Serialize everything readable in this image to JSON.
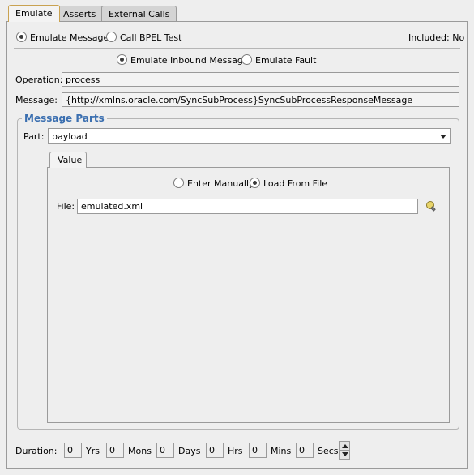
{
  "tabs": [
    {
      "label": "Emulate",
      "active": true
    },
    {
      "label": "Asserts",
      "active": false
    },
    {
      "label": "External Calls",
      "active": false
    }
  ],
  "mode": {
    "emulate_message": "Emulate Message",
    "call_bpel_test": "Call BPEL Test",
    "included": "Included: No",
    "selected": "emulate_message"
  },
  "direction": {
    "emulate_inbound": "Emulate Inbound Message",
    "emulate_fault": "Emulate Fault",
    "selected": "emulate_inbound"
  },
  "operation": {
    "label": "Operation:",
    "value": "process"
  },
  "message": {
    "label": "Message:",
    "value": "{http://xmlns.oracle.com/SyncSubProcess}SyncSubProcessResponseMessage"
  },
  "message_parts": {
    "title": "Message Parts",
    "part_label": "Part:",
    "part_value": "payload",
    "value_tab": "Value",
    "enter_manually": "Enter Manually",
    "load_from_file": "Load From File",
    "selected_source": "load_from_file",
    "file_label": "File:",
    "file_value": "emulated.xml",
    "browse_icon": "flashlight-icon"
  },
  "duration": {
    "label": "Duration:",
    "units": [
      {
        "value": "0",
        "unit": "Yrs"
      },
      {
        "value": "0",
        "unit": "Mons"
      },
      {
        "value": "0",
        "unit": "Days"
      },
      {
        "value": "0",
        "unit": "Hrs"
      },
      {
        "value": "0",
        "unit": "Mins"
      },
      {
        "value": "0",
        "unit": "Secs"
      }
    ]
  }
}
